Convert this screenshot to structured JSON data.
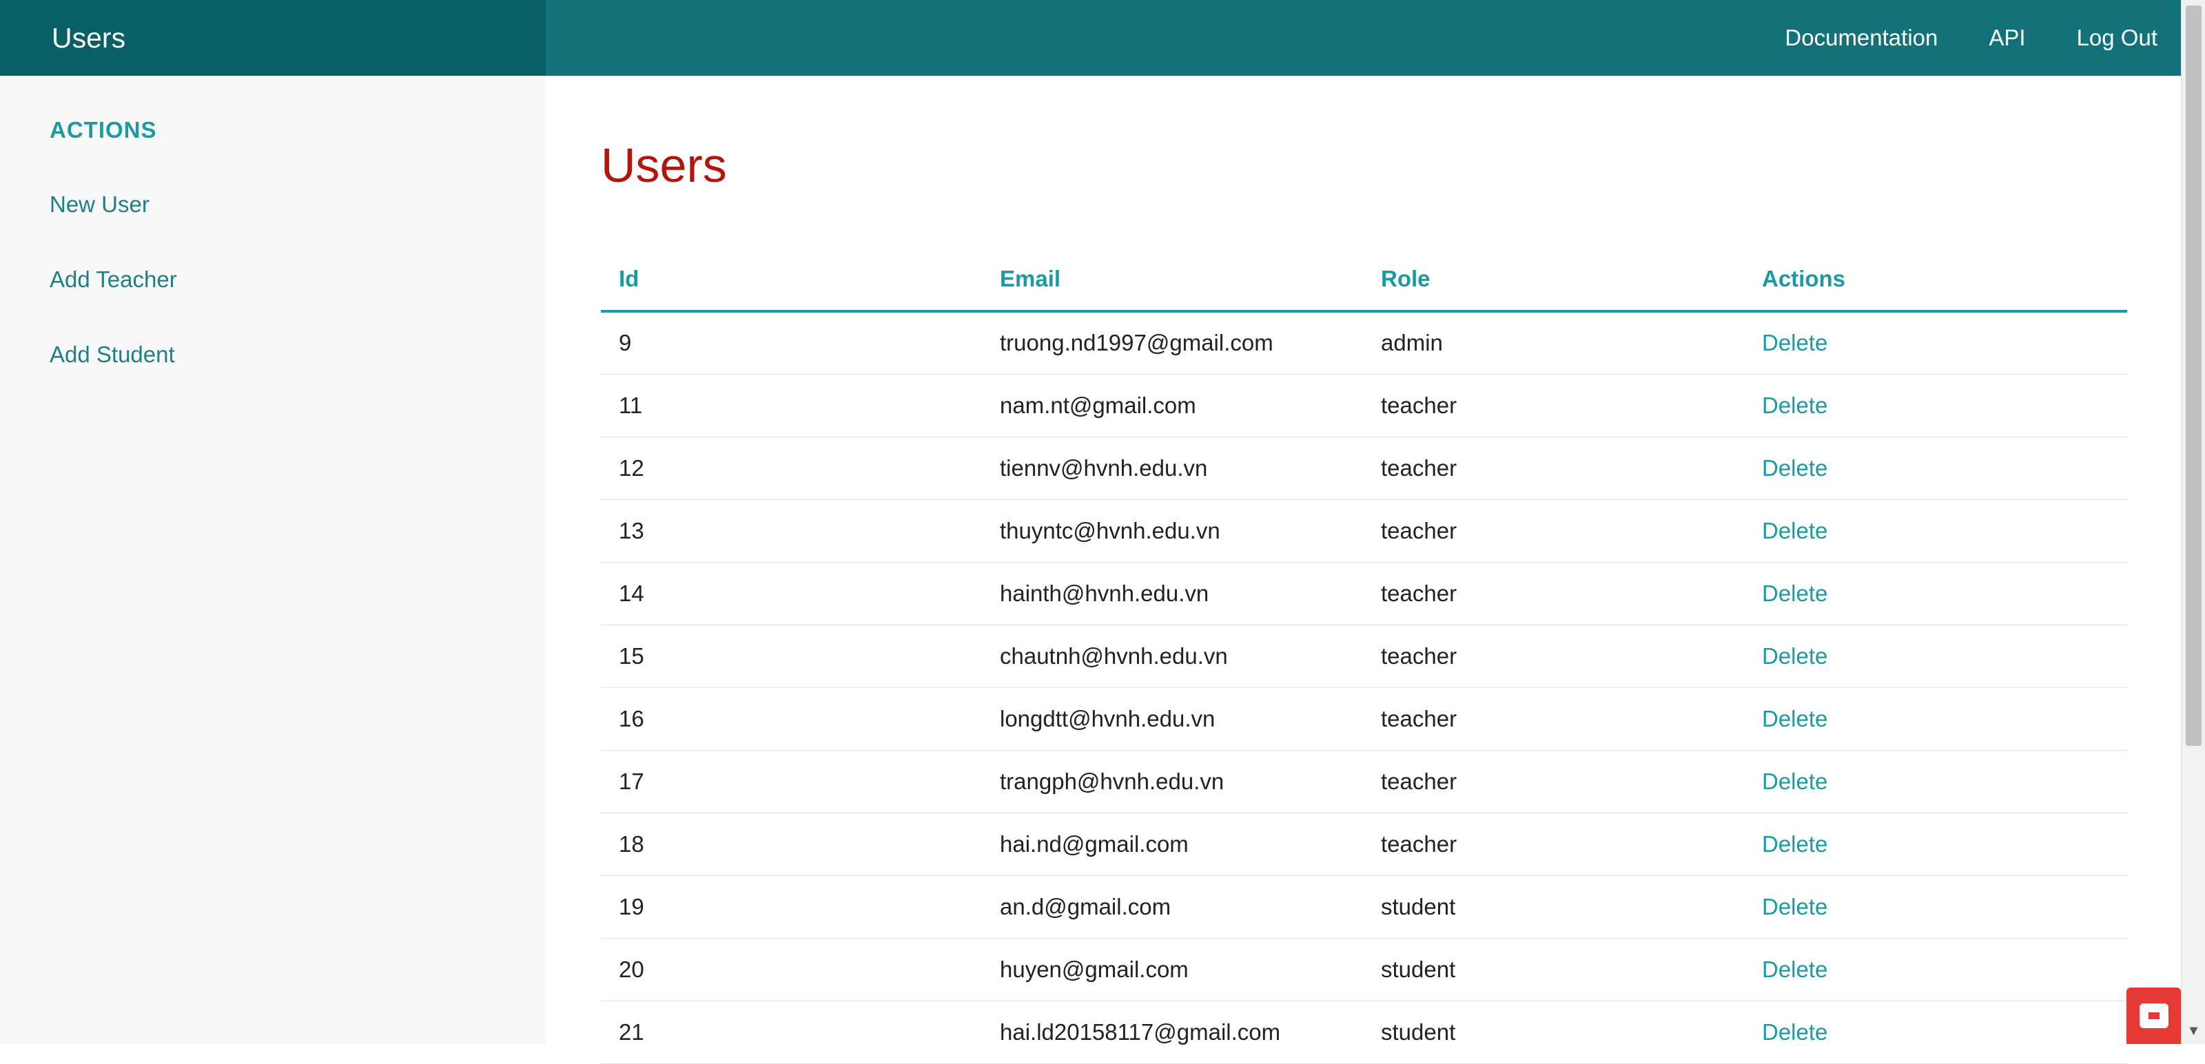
{
  "header": {
    "brand": "Users",
    "nav": [
      "Documentation",
      "API",
      "Log Out"
    ]
  },
  "sidebar": {
    "heading": "ACTIONS",
    "items": [
      "New User",
      "Add Teacher",
      "Add Student"
    ]
  },
  "main": {
    "title": "Users",
    "table": {
      "columns": [
        "Id",
        "Email",
        "Role",
        "Actions"
      ],
      "rows": [
        {
          "id": "9",
          "email": "truong.nd1997@gmail.com",
          "role": "admin",
          "action": "Delete"
        },
        {
          "id": "11",
          "email": "nam.nt@gmail.com",
          "role": "teacher",
          "action": "Delete"
        },
        {
          "id": "12",
          "email": "tiennv@hvnh.edu.vn",
          "role": "teacher",
          "action": "Delete"
        },
        {
          "id": "13",
          "email": "thuyntc@hvnh.edu.vn",
          "role": "teacher",
          "action": "Delete"
        },
        {
          "id": "14",
          "email": "hainth@hvnh.edu.vn",
          "role": "teacher",
          "action": "Delete"
        },
        {
          "id": "15",
          "email": "chautnh@hvnh.edu.vn",
          "role": "teacher",
          "action": "Delete"
        },
        {
          "id": "16",
          "email": "longdtt@hvnh.edu.vn",
          "role": "teacher",
          "action": "Delete"
        },
        {
          "id": "17",
          "email": "trangph@hvnh.edu.vn",
          "role": "teacher",
          "action": "Delete"
        },
        {
          "id": "18",
          "email": "hai.nd@gmail.com",
          "role": "teacher",
          "action": "Delete"
        },
        {
          "id": "19",
          "email": "an.d@gmail.com",
          "role": "student",
          "action": "Delete"
        },
        {
          "id": "20",
          "email": "huyen@gmail.com",
          "role": "student",
          "action": "Delete"
        },
        {
          "id": "21",
          "email": "hai.ld20158117@gmail.com",
          "role": "student",
          "action": "Delete"
        }
      ]
    }
  },
  "icons": {
    "scroll_down": "chevron-down-icon",
    "widget": "chat-widget-icon"
  },
  "colors": {
    "header_bg": "#137179",
    "brand_bg": "#085f66",
    "accent": "#1b9aa3",
    "title": "#b5140b",
    "widget": "#e53935"
  }
}
